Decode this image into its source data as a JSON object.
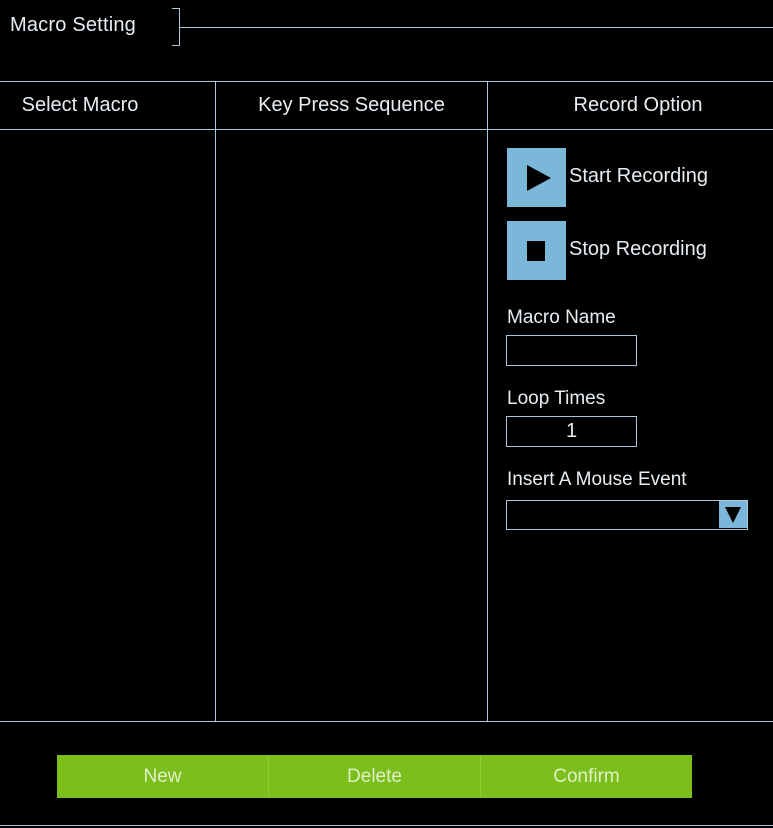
{
  "header": {
    "title": "Macro Setting"
  },
  "columns": {
    "select_macro": "Select Macro",
    "key_press_sequence": "Key Press Sequence",
    "record_option": "Record Option"
  },
  "record": {
    "start_label": "Start Recording",
    "stop_label": "Stop Recording",
    "start_icon": "play-icon",
    "stop_icon": "stop-icon"
  },
  "fields": {
    "macro_name_label": "Macro Name",
    "macro_name_value": "",
    "loop_times_label": "Loop Times",
    "loop_times_value": "1",
    "mouse_event_label": "Insert A Mouse Event",
    "mouse_event_value": ""
  },
  "actions": {
    "new_label": "New",
    "delete_label": "Delete",
    "confirm_label": "Confirm"
  },
  "colors": {
    "background": "#000000",
    "line": "#a9c6da",
    "button_blue": "#7bb7d9",
    "action_green": "#7cbf1c"
  }
}
